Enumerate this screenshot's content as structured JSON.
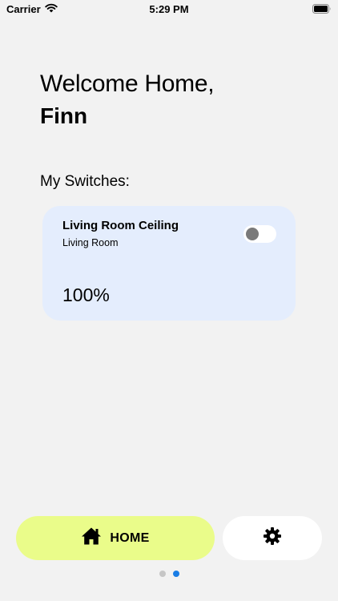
{
  "status_bar": {
    "carrier": "Carrier",
    "time": "5:29 PM"
  },
  "greeting": {
    "welcome": "Welcome Home,",
    "name": "Finn"
  },
  "switches_section": {
    "title": "My Switches:",
    "items": [
      {
        "name": "Living Room Ceiling",
        "room": "Living Room",
        "level": "100%",
        "on": false
      }
    ]
  },
  "nav": {
    "home_label": "HOME",
    "home_icon": "house-icon",
    "settings_icon": "gear-icon",
    "page_count": 2,
    "active_page": 2
  },
  "colors": {
    "background": "#f2f2f2",
    "card": "#e4edfd",
    "home_button": "#eafc8a",
    "active_dot": "#1a7de5"
  }
}
